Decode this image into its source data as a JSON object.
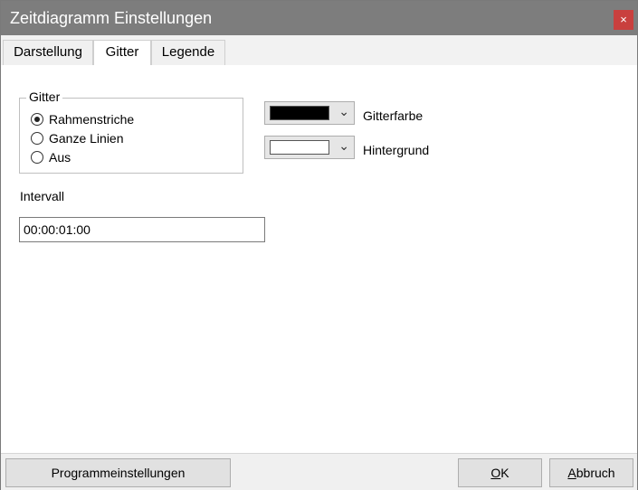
{
  "window": {
    "title": "Zeitdiagramm Einstellungen",
    "close_glyph": "×"
  },
  "tabs": [
    {
      "label": "Darstellung",
      "active": false
    },
    {
      "label": "Gitter",
      "active": true
    },
    {
      "label": "Legende",
      "active": false
    }
  ],
  "grid_group": {
    "legend": "Gitter",
    "options": [
      {
        "label": "Rahmenstriche",
        "checked": true
      },
      {
        "label": "Ganze Linien",
        "checked": false
      },
      {
        "label": "Aus",
        "checked": false
      }
    ]
  },
  "grid_color": {
    "label": "Gitterfarbe",
    "value": "#000000"
  },
  "background_color": {
    "label": "Hintergrund",
    "value": "#ffffff"
  },
  "interval": {
    "label": "Intervall",
    "value": "00:00:01:00"
  },
  "footer": {
    "program_settings": "Programmeinstellungen",
    "ok_mnemonic": "O",
    "ok_rest": "K",
    "cancel_mnemonic": "A",
    "cancel_rest": "bbruch"
  }
}
